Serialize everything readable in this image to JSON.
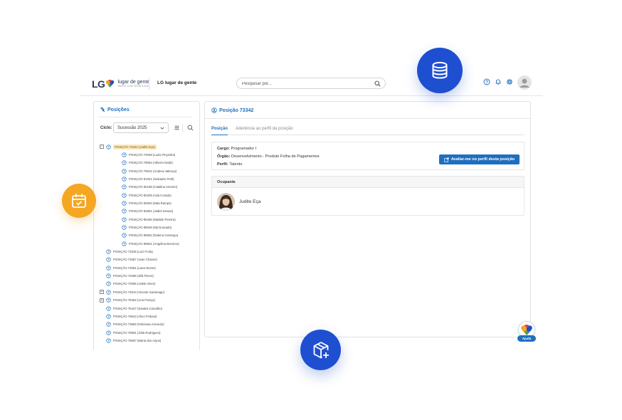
{
  "header": {
    "logo_lg": "LG",
    "logo_line1": "lugar de gente",
    "logo_line2": "GENTE COM TECNOLOGIA",
    "app_name": "LG lugar de gente",
    "search_placeholder": "Pesquisar por..."
  },
  "left_panel": {
    "title": "Posições",
    "cycle_label": "Ciclo:",
    "cycle_value": "Sucessão 2025",
    "tree": [
      {
        "label": "POSIÇÃO 73342 (Judite Eça)",
        "level": 0,
        "expander": "−",
        "selected": true
      },
      {
        "label": "POSIÇÃO 74069 (Luzia Peçanha)",
        "level": 1
      },
      {
        "label": "POSIÇÃO 78083 (Alberto Nadir)",
        "level": 1
      },
      {
        "label": "POSIÇÃO 79022 (Andrea Valença)",
        "level": 1
      },
      {
        "label": "POSIÇÃO 81931 (Salvador Petit)",
        "level": 1
      },
      {
        "label": "POSIÇÃO 82188 (Catalina Amorim)",
        "level": 1
      },
      {
        "label": "POSIÇÃO 82209 (Ada Curado)",
        "level": 1
      },
      {
        "label": "POSIÇÃO 82920 (Itala Ramps)",
        "level": 1
      },
      {
        "label": "POSIÇÃO 82861 (Jadiel Seixas)",
        "level": 1
      },
      {
        "label": "POSIÇÃO 85456 (Matilde Pereira)",
        "level": 1
      },
      {
        "label": "POSIÇÃO 85549 (Itai Dourado)",
        "level": 1
      },
      {
        "label": "POSIÇÃO 85552 (Dalena Camargo)",
        "level": 1
      },
      {
        "label": "POSIÇÃO 85551 (Angelina Bonomo)",
        "level": 1
      },
      {
        "label": "POSIÇÃO 73335 (Luiz Frota)",
        "level": 0
      },
      {
        "label": "POSIÇÃO 73387 (Jean Chaves)",
        "level": 0
      },
      {
        "label": "POSIÇÃO 73391 (Lana Neves)",
        "level": 0
      },
      {
        "label": "POSIÇÃO 73396 (Zilá Flores)",
        "level": 0
      },
      {
        "label": "POSIÇÃO 73396 (Adele Alves)",
        "level": 0
      },
      {
        "label": "POSIÇÃO 74044 (Vicente Saramago)",
        "level": 0,
        "expander": "+"
      },
      {
        "label": "POSIÇÃO 75452 (Ana França)",
        "level": 0,
        "expander": "+"
      },
      {
        "label": "POSIÇÃO 75427 (Sandra Carvalho)",
        "level": 0
      },
      {
        "label": "POSIÇÃO 76843 (Aluci Feitosa)",
        "level": 0
      },
      {
        "label": "POSIÇÃO 73682 (Feliciana Azevedo)",
        "level": 0
      },
      {
        "label": "POSIÇÃO 75581 (Júlia Rodrigues)",
        "level": 0
      },
      {
        "label": "POSIÇÃO 75597 (Maria dos Anjos)",
        "level": 0
      }
    ]
  },
  "right_panel": {
    "title": "Posição 73342",
    "tabs": [
      {
        "label": "Posição",
        "active": true
      },
      {
        "label": "Aderência ao perfil da posição",
        "active": false
      }
    ],
    "cargo_label": "Cargo:",
    "cargo_value": "Programador I",
    "orgao_label": "Órgão:",
    "orgao_value": "Desenvolvimento - Produto Folha de Pagamentos",
    "perfil_label": "Perfil:",
    "perfil_value": "Talento",
    "evaluate_button": "Avaliar-me no perfil desta posição",
    "occupant_header": "Ocupante",
    "occupant_name": "Judite Eça"
  },
  "help": {
    "label": "Ajuda"
  },
  "colors": {
    "brand_blue": "#1e6fbf",
    "accent_blue": "#1f4fd1",
    "accent_orange": "#f5a623",
    "selected_highlight": "#fde8b8"
  },
  "icons": {
    "floating": [
      "database-icon",
      "calendar-check-icon",
      "package-add-icon"
    ],
    "topbar": [
      "help-icon",
      "bell-icon",
      "gear-icon",
      "user-avatar-icon"
    ]
  }
}
